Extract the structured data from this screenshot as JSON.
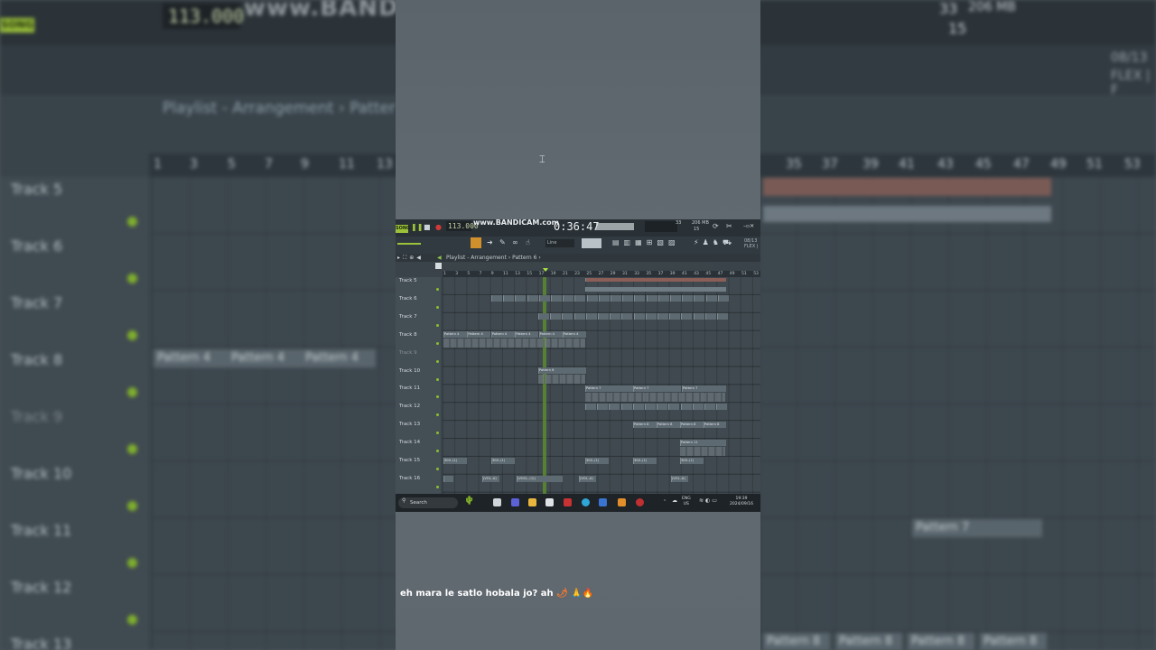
{
  "background": {
    "song_label": "SONG",
    "tempo": "113.000",
    "bandicam_label": "www.BANDICAM.com",
    "playlist_title": "Playlist - Arrangement",
    "playlist_pattern": "Patter",
    "memory": "206 MB",
    "mem_count_a": "33",
    "mem_count_b": "15",
    "date_badge": "08/13",
    "flex_label": "FLEX | F",
    "ruler_left": [
      "1",
      "3",
      "5",
      "7",
      "9",
      "11",
      "13"
    ],
    "ruler_right": [
      "35",
      "37",
      "39",
      "41",
      "43",
      "45",
      "47",
      "49",
      "51",
      "53"
    ],
    "tracks": [
      "Track 5",
      "Track 6",
      "Track 7",
      "Track 8",
      "Track 9",
      "Track 10",
      "Track 11",
      "Track 12",
      "Track 13"
    ],
    "pattern4": "Pattern 4",
    "pattern7": "Pattern 7",
    "pattern8": "Pattern 8"
  },
  "window": {
    "song_label": "SONG",
    "tempo": "113.000",
    "bandicam_label": "www.BANDICAM.com",
    "timer": "0:36:47",
    "memory": "206 MB",
    "mem_a": "33",
    "mem_b": "15",
    "snap": "Line",
    "flex_date": "08/13",
    "flex_label": "FLEX |",
    "playlist_title": "Playlist - Arrangement",
    "pattern_label": "Pattern 6",
    "ruler": [
      "1",
      "3",
      "5",
      "7",
      "9",
      "11",
      "13",
      "15",
      "17",
      "19",
      "21",
      "23",
      "25",
      "27",
      "29",
      "31",
      "33",
      "35",
      "37",
      "39",
      "41",
      "43",
      "45",
      "47",
      "49",
      "51",
      "53"
    ],
    "tracks": [
      "Track 5",
      "Track 6",
      "Track 7",
      "Track 8",
      "Track 9",
      "Track 10",
      "Track 11",
      "Track 12",
      "Track 13",
      "Track 14",
      "Track 15",
      "Track 16"
    ],
    "clip_pattern4": "Pattern 4",
    "clip_pattern6": "Pattern 6",
    "clip_pattern7": "Pattern 7",
    "clip_pattern8": "Pattern 8",
    "clip_pattern11": "Pattern 11",
    "clip_small_a": "300..(1)",
    "clip_small_b": "(VOL..A)",
    "clip_small_c": "(VOCL..(1))"
  },
  "taskbar": {
    "search_placeholder": "Search",
    "lang": "ENG",
    "region": "US",
    "time": "19:39",
    "date": "2024/09/16"
  },
  "caption": {
    "text": "eh mara le satlo hobala jo? ah",
    "emoji": "🌶 🙏🔥"
  }
}
